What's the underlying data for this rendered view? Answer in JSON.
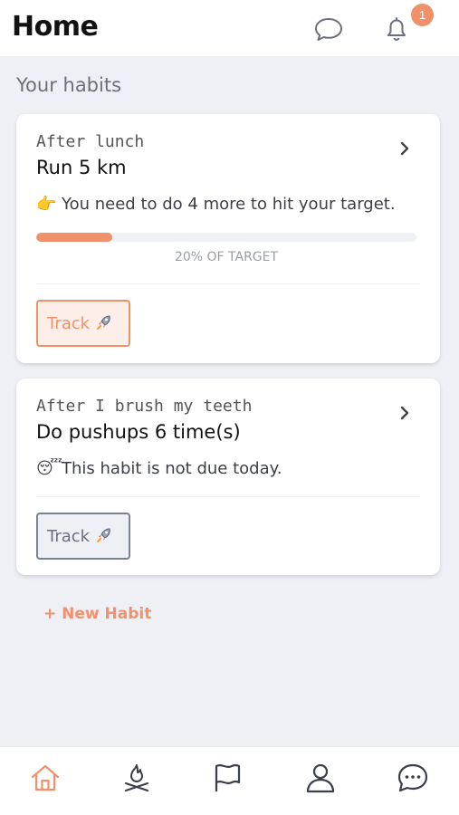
{
  "header": {
    "title": "Home",
    "notification_count": "1",
    "accent_color": "#f0916b"
  },
  "section": {
    "title": "Your habits"
  },
  "habits": [
    {
      "cue": "After lunch",
      "name": "Run 5 km",
      "note_emoji": "👉",
      "note": "You need to do 4 more to hit your target.",
      "progress_percent": 20,
      "progress_label": "20% OF TARGET",
      "track_label": "Track",
      "track_icon": "rocket-icon",
      "track_state": "active"
    },
    {
      "cue": "After I brush my teeth",
      "name": "Do pushups 6 time(s)",
      "note_emoji": "😴",
      "note": "This habit is not due today.",
      "track_label": "Track",
      "track_icon": "rocket-icon",
      "track_state": "inactive"
    }
  ],
  "new_habit_label": "+ New Habit",
  "tabbar": {
    "items": [
      {
        "icon": "home-icon",
        "active": true
      },
      {
        "icon": "campfire-icon",
        "active": false
      },
      {
        "icon": "flag-icon",
        "active": false
      },
      {
        "icon": "profile-icon",
        "active": false
      },
      {
        "icon": "chat-bubble-icon",
        "active": false
      }
    ]
  }
}
